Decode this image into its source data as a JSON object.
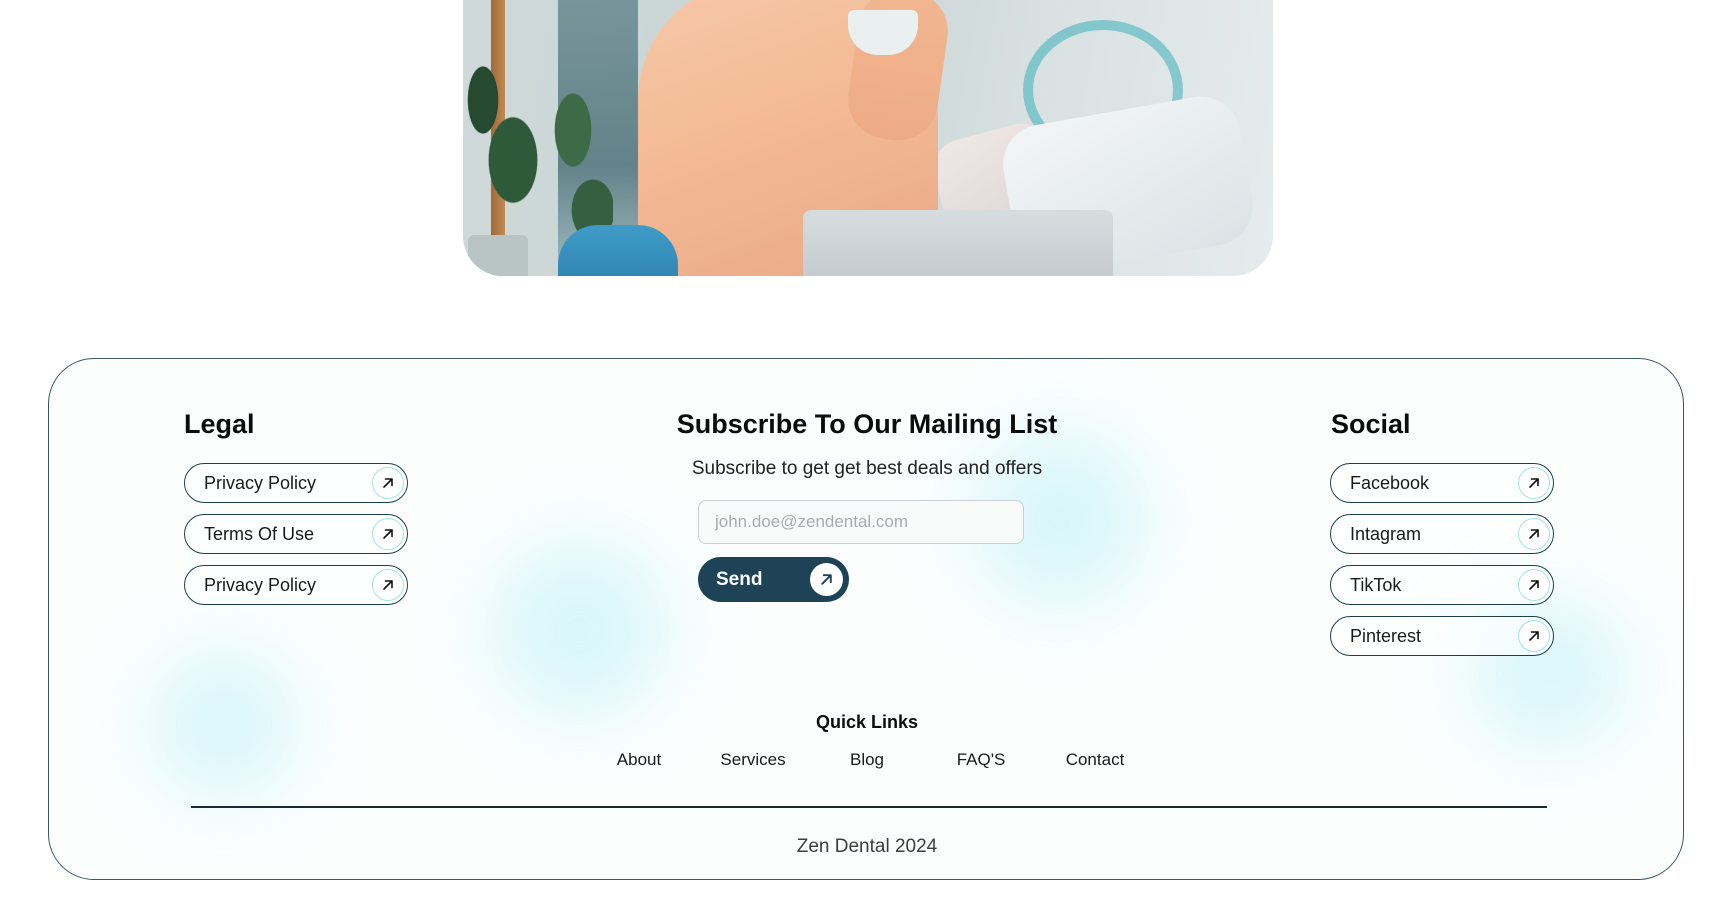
{
  "hero": {
    "image_alt": ""
  },
  "legal": {
    "title": "Legal",
    "items": [
      {
        "label": "Privacy Policy"
      },
      {
        "label": "Terms Of Use"
      },
      {
        "label": "Privacy Policy"
      }
    ]
  },
  "subscribe": {
    "title": "Subscribe To Our Mailing List",
    "description": "Subscribe to get get best deals and offers",
    "email_placeholder": "john.doe@zendental.com",
    "email_value": "",
    "send_label": "Send"
  },
  "social": {
    "title": "Social",
    "items": [
      {
        "label": "Facebook"
      },
      {
        "label": "Intagram"
      },
      {
        "label": "TikTok"
      },
      {
        "label": "Pinterest"
      }
    ]
  },
  "quick_links": {
    "title": "Quick Links",
    "items": [
      {
        "label": "About"
      },
      {
        "label": "Services"
      },
      {
        "label": "Blog"
      },
      {
        "label": "FAQ'S"
      },
      {
        "label": "Contact"
      }
    ]
  },
  "copyright": "Zen Dental 2024",
  "icons": {
    "pill_arrow": "arrow-up-right-icon",
    "send_arrow": "arrow-up-right-icon"
  },
  "colors": {
    "primary": "#1f4356",
    "border": "#3a5566",
    "accent_glow": "#bdf1f8",
    "arrow_ring": "#9fe3ec"
  }
}
